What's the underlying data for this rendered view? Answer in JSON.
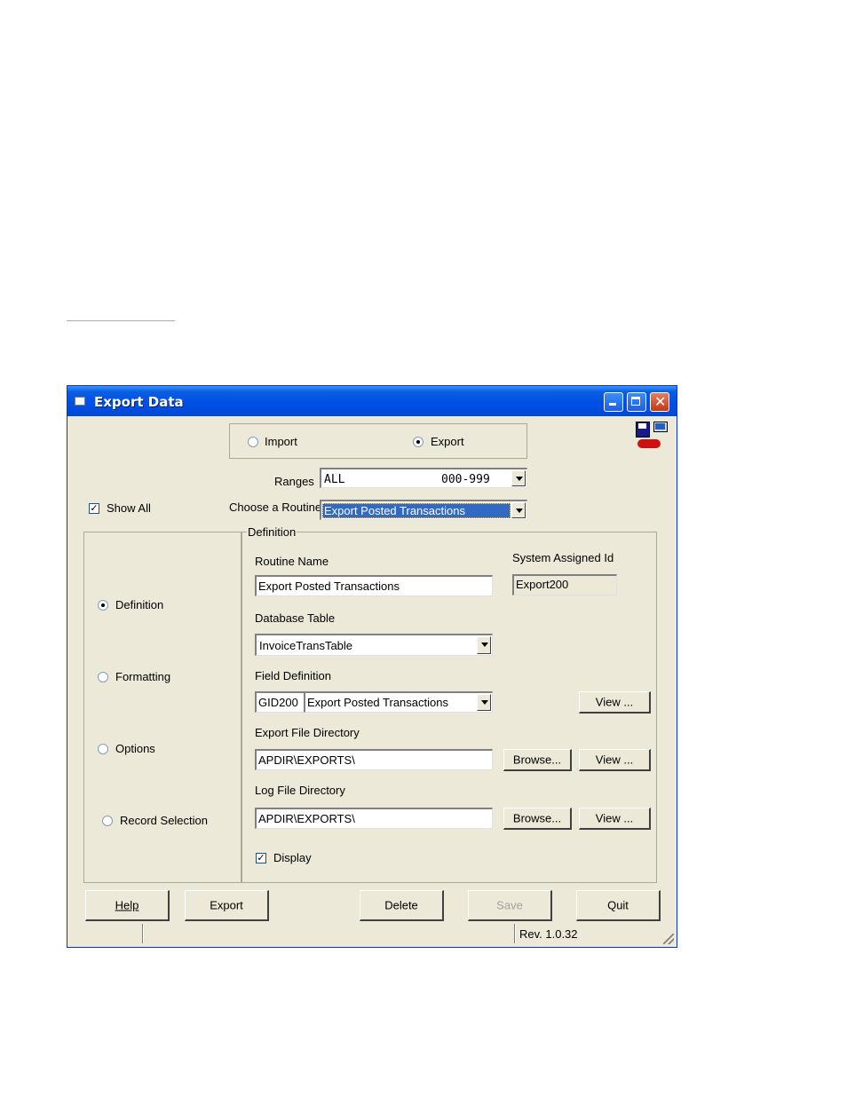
{
  "window": {
    "title": "Export Data"
  },
  "mode": {
    "import_label": "Import",
    "export_label": "Export",
    "selected": "export"
  },
  "ranges": {
    "label": "Ranges",
    "value_left": "ALL",
    "value_right": "000-999"
  },
  "show_all": {
    "label": "Show All",
    "checked": true
  },
  "routine": {
    "label": "Choose a Routine",
    "value": "Export Posted Transactions"
  },
  "nav": {
    "definition": "Definition",
    "formatting": "Formatting",
    "options": "Options",
    "record_selection": "Record Selection"
  },
  "definition": {
    "group_label": "Definition",
    "routine_name_label": "Routine Name",
    "routine_name_value": "Export Posted Transactions",
    "system_id_label": "System Assigned Id",
    "system_id_value": "Export200",
    "db_table_label": "Database Table",
    "db_table_value": "InvoiceTransTable",
    "field_def_label": "Field Definition",
    "field_def_code": "GID200",
    "field_def_value": "Export Posted Transactions",
    "export_dir_label": "Export File Directory",
    "export_dir_value": "APDIR\\EXPORTS\\",
    "log_dir_label": "Log File Directory",
    "log_dir_value": "APDIR\\EXPORTS\\",
    "display_label": "Display",
    "view_label": "View ...",
    "browse_label": "Browse..."
  },
  "buttons": {
    "help": "Help",
    "export": "Export",
    "delete": "Delete",
    "save": "Save",
    "quit": "Quit"
  },
  "status": {
    "revision": "Rev. 1.0.32"
  }
}
